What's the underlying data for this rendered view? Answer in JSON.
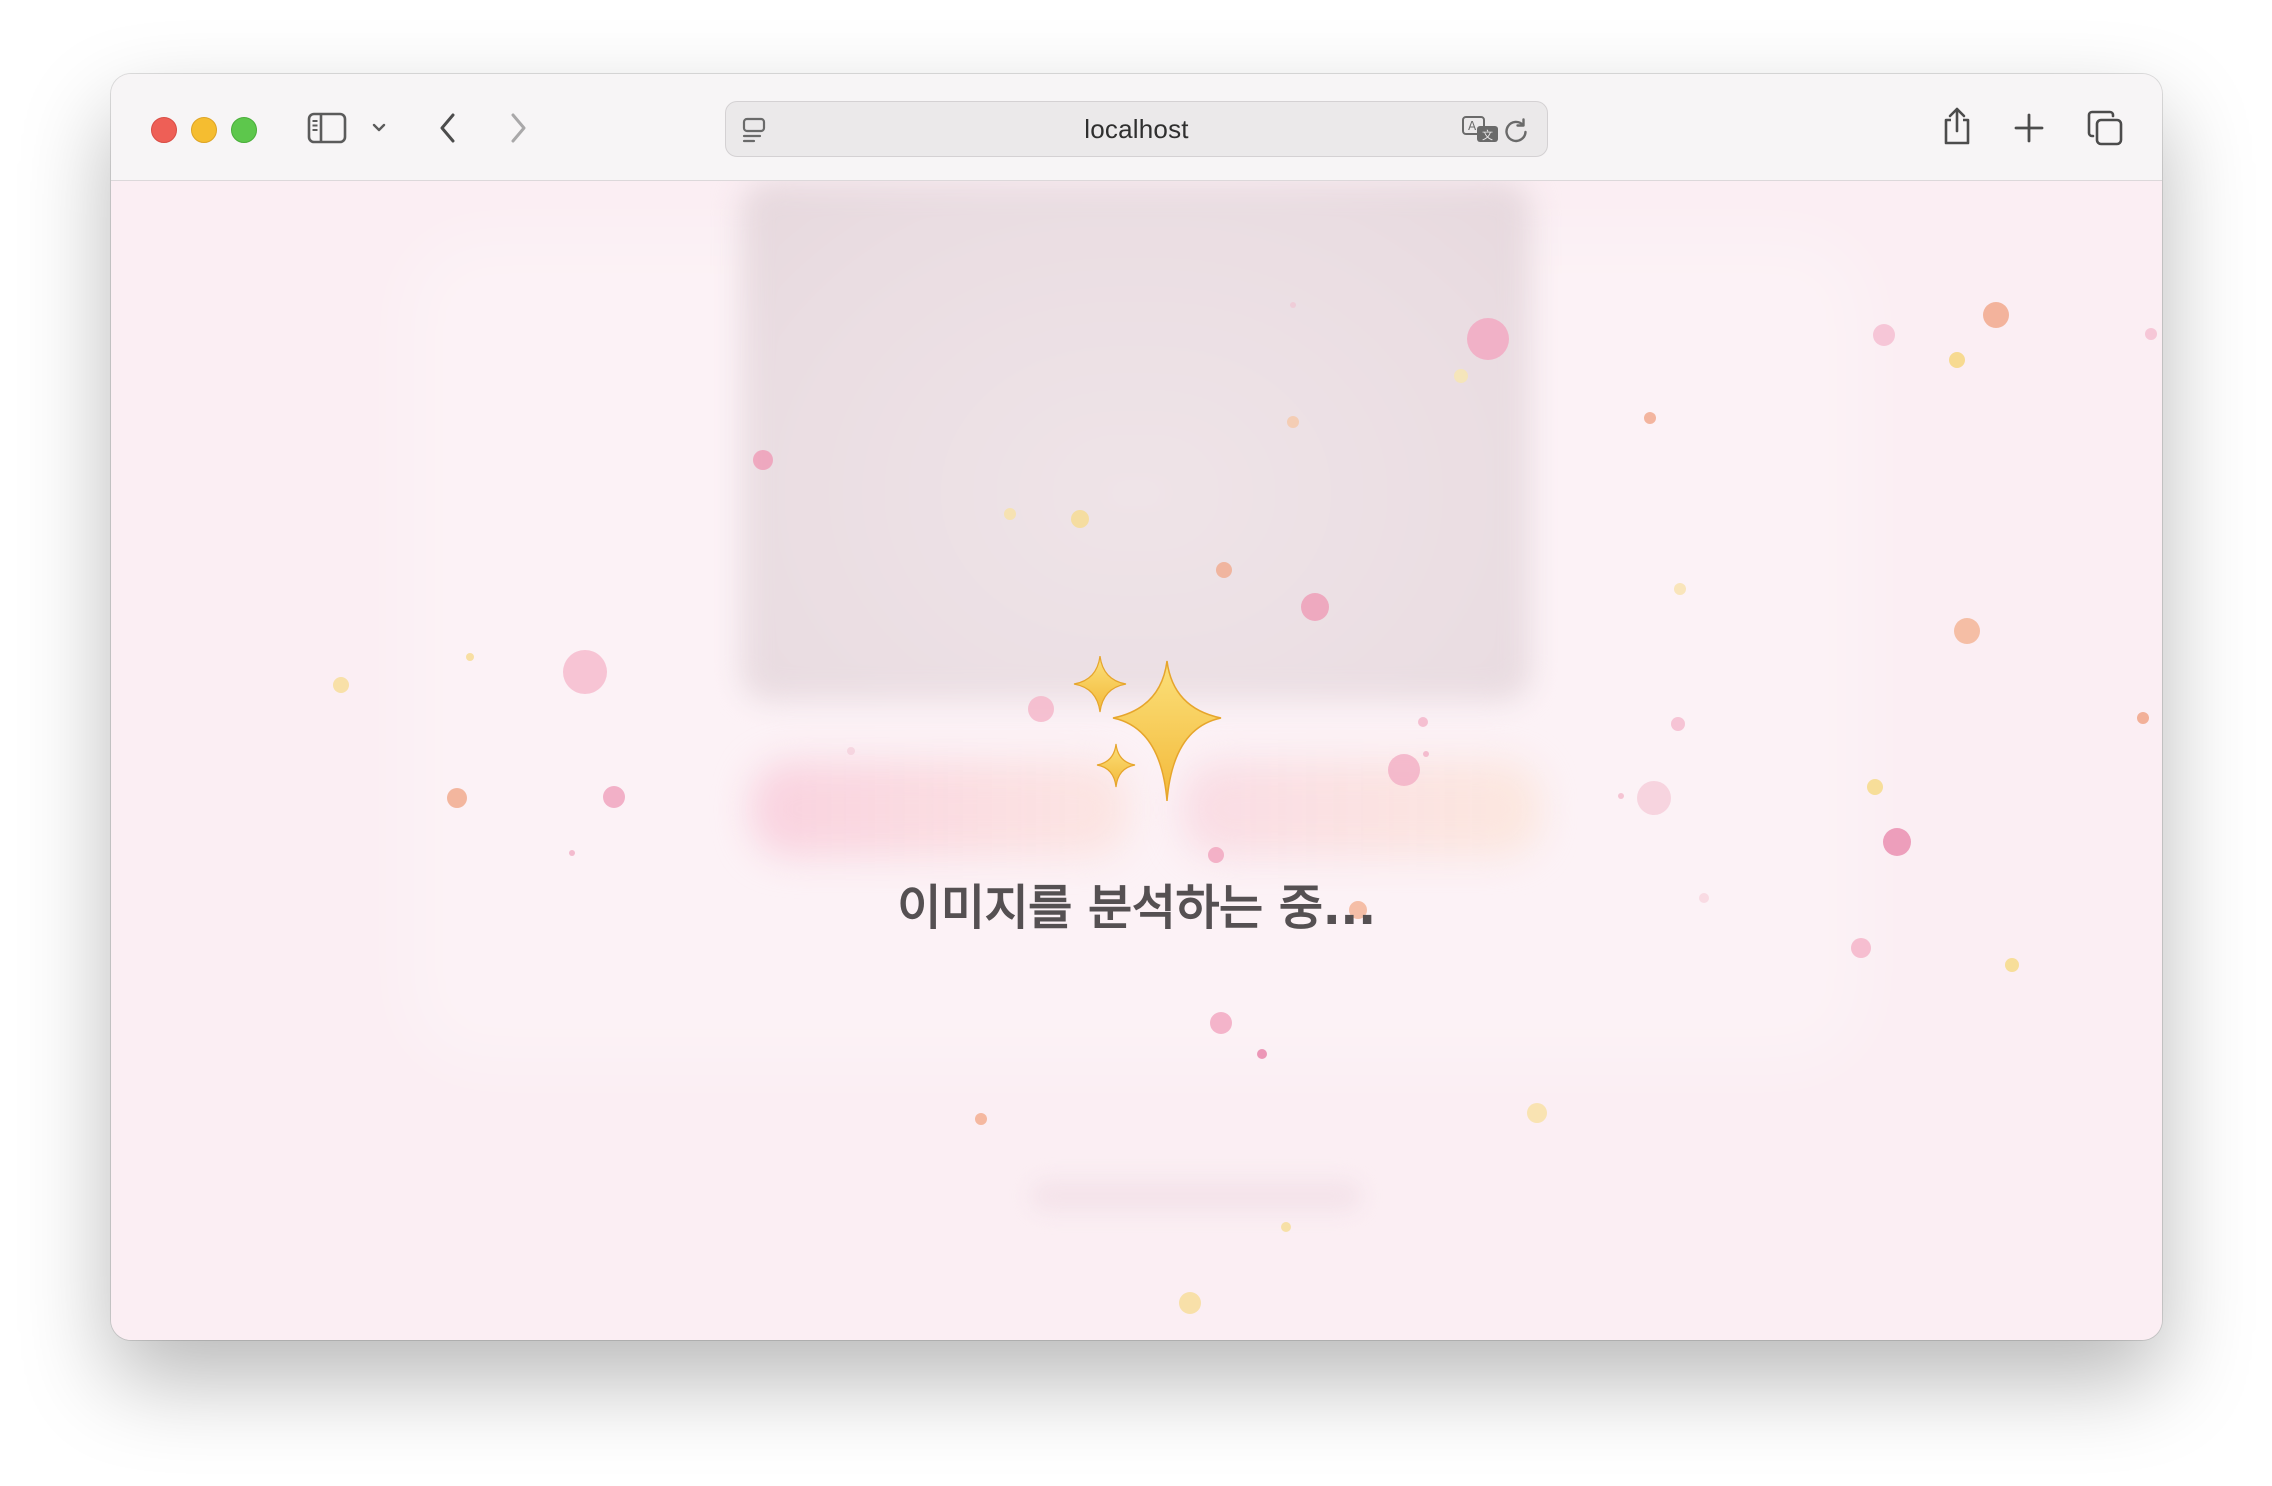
{
  "browser": {
    "url_host": "localhost",
    "traffic_lights": {
      "close_color": "#ee5f56",
      "minimize_color": "#f5bd30",
      "maximize_color": "#5dc74c"
    },
    "icons": {
      "sidebar": "sidebar-icon",
      "sidebar_menu": "chevron-down-icon",
      "back": "chevron-left-icon",
      "forward": "chevron-right-icon",
      "page_menu": "page-menu-icon",
      "translate": "translate-icon",
      "reload": "reload-icon",
      "share": "share-icon",
      "new_tab": "plus-icon",
      "tab_overview": "tabs-icon"
    }
  },
  "page": {
    "loading_text": "이미지를 분석하는 중...",
    "loading_icon": "sparkles-icon",
    "background_color": "#fbeef3",
    "accent_colors": [
      "#f0a3bd",
      "#f4ad8d",
      "#f7dc8a"
    ]
  }
}
